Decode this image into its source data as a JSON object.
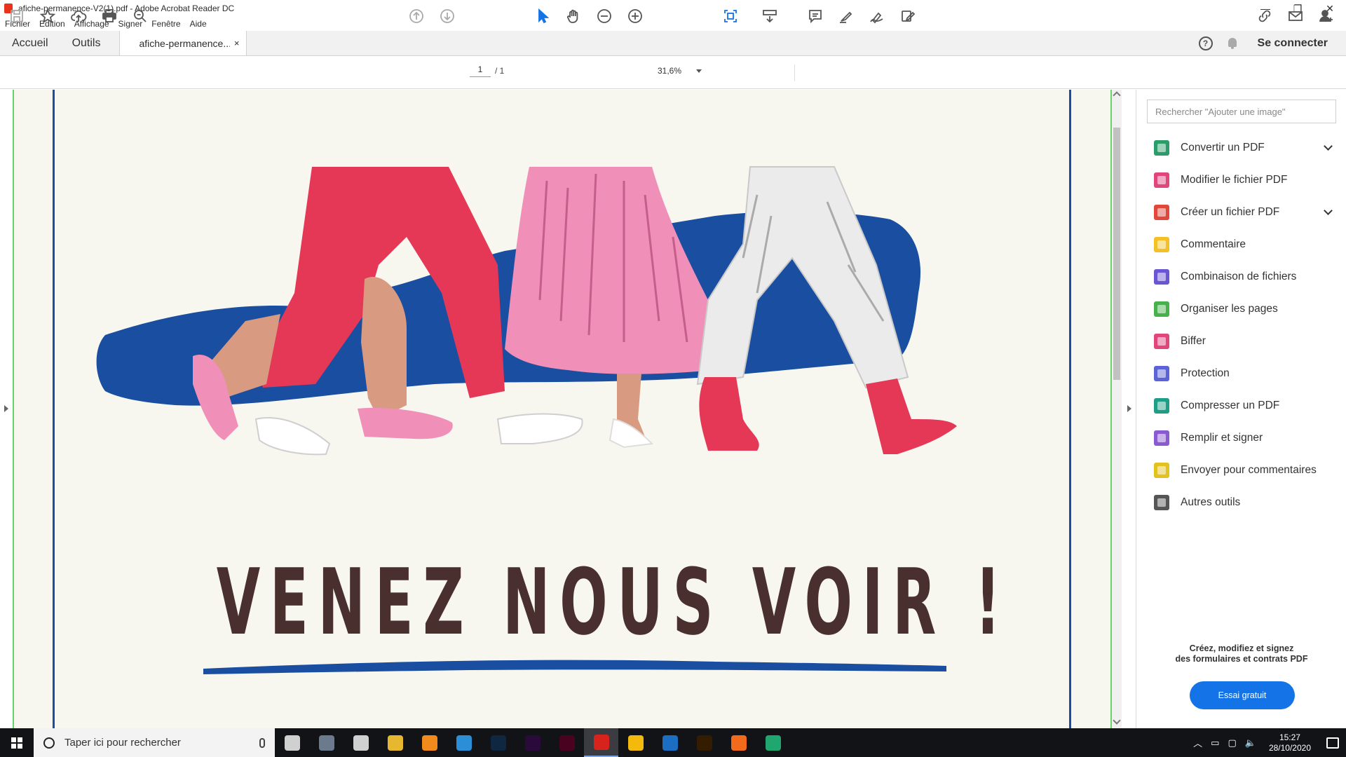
{
  "window": {
    "title": "afiche-permanence-V2(1).pdf - Adobe Acrobat Reader DC",
    "controls": [
      "—",
      "❐",
      "✕"
    ]
  },
  "menu": [
    "Fichier",
    "Edition",
    "Affichage",
    "Signer",
    "Fenêtre",
    "Aide"
  ],
  "tabs": {
    "home": "Accueil",
    "tools": "Outils",
    "document": "afiche-permanence...",
    "close": "×",
    "help": "?",
    "signin": "Se connecter"
  },
  "toolbar": {
    "page_current": "1",
    "page_total": "/ 1",
    "zoom": "31,6%"
  },
  "document": {
    "headline": "VENEZ NOUS VOIR !"
  },
  "pane": {
    "search_placeholder": "Rechercher \"Ajouter une image\"",
    "tools": [
      {
        "label": "Convertir un PDF",
        "color": "#2a9d6b",
        "expand": true
      },
      {
        "label": "Modifier le fichier PDF",
        "color": "#e0457b",
        "expand": false
      },
      {
        "label": "Créer un fichier PDF",
        "color": "#e0483c",
        "expand": true
      },
      {
        "label": "Commentaire",
        "color": "#f3c026",
        "expand": false
      },
      {
        "label": "Combinaison de fichiers",
        "color": "#6a55d4",
        "expand": false
      },
      {
        "label": "Organiser les pages",
        "color": "#48b04c",
        "expand": false
      },
      {
        "label": "Biffer",
        "color": "#e0457b",
        "expand": false
      },
      {
        "label": "Protection",
        "color": "#5b63d6",
        "expand": false
      },
      {
        "label": "Compresser un PDF",
        "color": "#1e9e86",
        "expand": false
      },
      {
        "label": "Remplir et signer",
        "color": "#8a5ad2",
        "expand": false
      },
      {
        "label": "Envoyer pour commentaires",
        "color": "#e3c21f",
        "expand": false
      },
      {
        "label": "Autres outils",
        "color": "#555555",
        "expand": false
      }
    ],
    "promo_line1": "Créez, modifiez et signez",
    "promo_line2": "des formulaires et contrats PDF",
    "trial_button": "Essai gratuit"
  },
  "taskbar": {
    "search_placeholder": "Taper ici pour rechercher",
    "apps": [
      {
        "name": "task-view",
        "color": "#d0d0d0"
      },
      {
        "name": "calculator",
        "color": "#6b7a8c"
      },
      {
        "name": "settings",
        "color": "#d0d0d0"
      },
      {
        "name": "file-explorer",
        "color": "#e8b730"
      },
      {
        "name": "vlc",
        "color": "#f08a1c"
      },
      {
        "name": "edge-legacy",
        "color": "#2b8fd8"
      },
      {
        "name": "photoshop",
        "color": "#0f2740"
      },
      {
        "name": "premiere",
        "color": "#2a0a3a"
      },
      {
        "name": "indesign",
        "color": "#49021f"
      },
      {
        "name": "acrobat",
        "color": "#d8231c",
        "active": true
      },
      {
        "name": "pinned-app",
        "color": "#f3b90d"
      },
      {
        "name": "outlook",
        "color": "#1b6ec2"
      },
      {
        "name": "illustrator",
        "color": "#331c00"
      },
      {
        "name": "firefox",
        "color": "#f26b1d"
      },
      {
        "name": "edge",
        "color": "#1fa76f"
      }
    ],
    "time": "15:27",
    "date": "28/10/2020",
    "notifications": "1"
  },
  "colors": {
    "accent": "#1473e6",
    "poster_blue": "#1a4ea0",
    "poster_red": "#e53857",
    "poster_pink": "#f08fb7",
    "headline": "#4a2f2f"
  }
}
